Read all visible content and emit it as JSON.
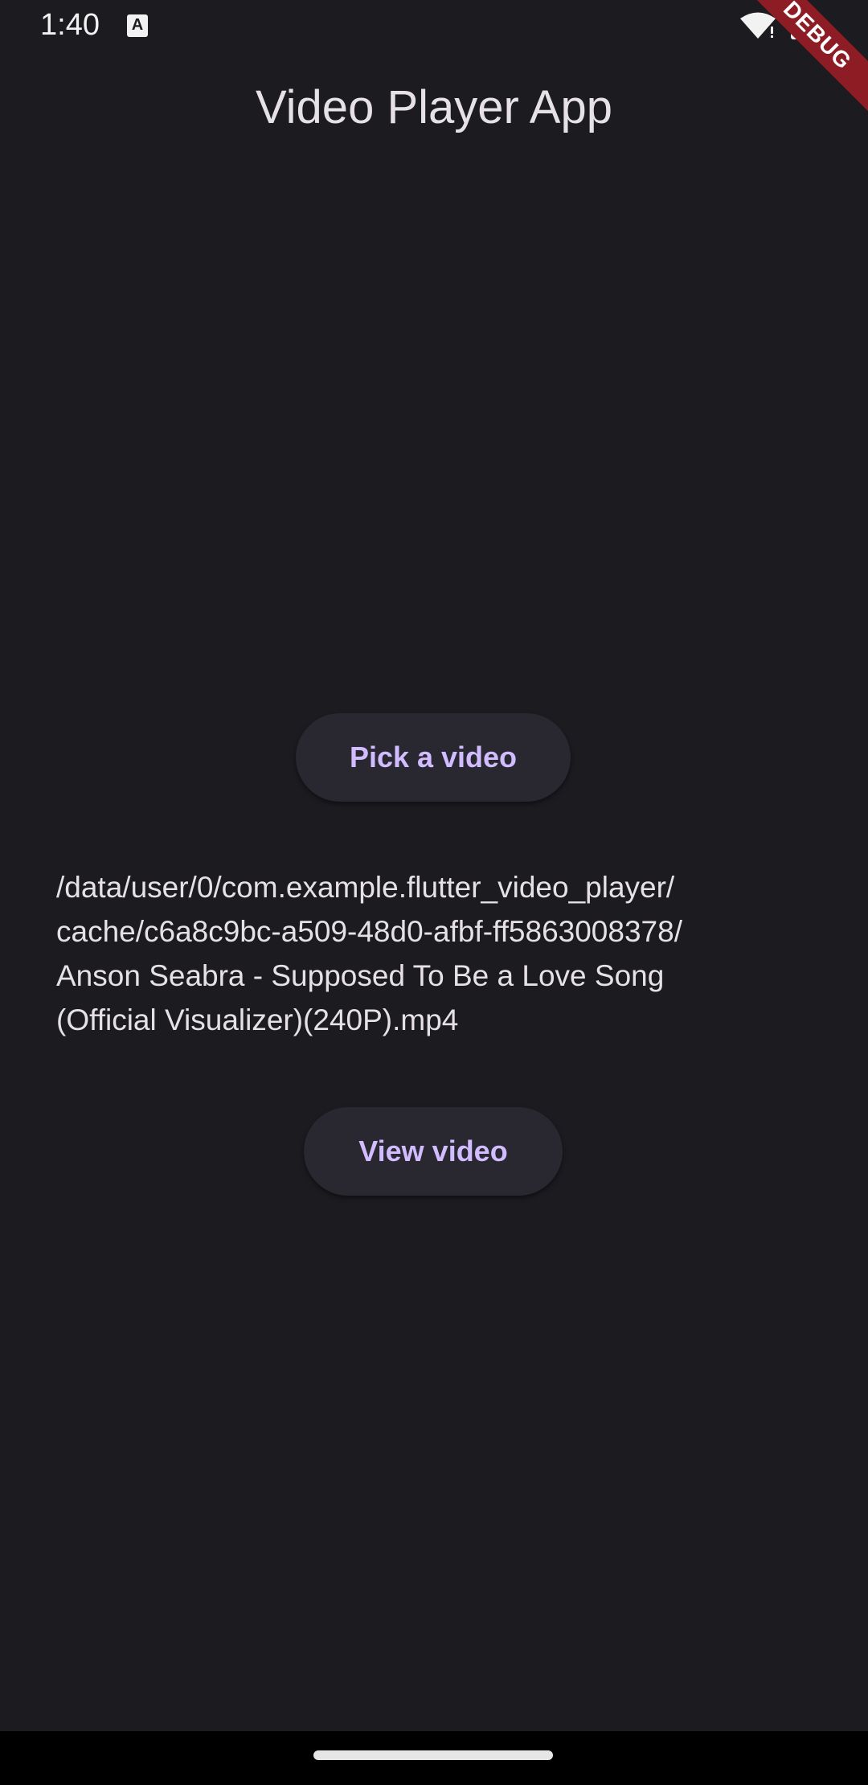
{
  "status_bar": {
    "time": "1:40",
    "notification_icon_letter": "A"
  },
  "debug_banner": {
    "label": "DEBUG"
  },
  "app_bar": {
    "title": "Video Player App"
  },
  "main": {
    "pick_button_label": "Pick a video",
    "file_path_lines": [
      "/data/user/0/com.example.flutter_video_player/",
      "cache/c6a8c9bc-a509-48d0-afbf-ff5863008378/",
      "Anson Seabra - Supposed To Be a Love Song",
      "(Official Visualizer)(240P).mp4"
    ],
    "view_button_label": "View video"
  },
  "colors": {
    "background": "#1c1b20",
    "button_background": "#29272f",
    "button_text": "#d0bcff",
    "debug_banner": "#8e1c24"
  },
  "icons": {
    "status_notification": "a-icon",
    "wifi": "wifi-icon",
    "battery": "battery-icon"
  }
}
